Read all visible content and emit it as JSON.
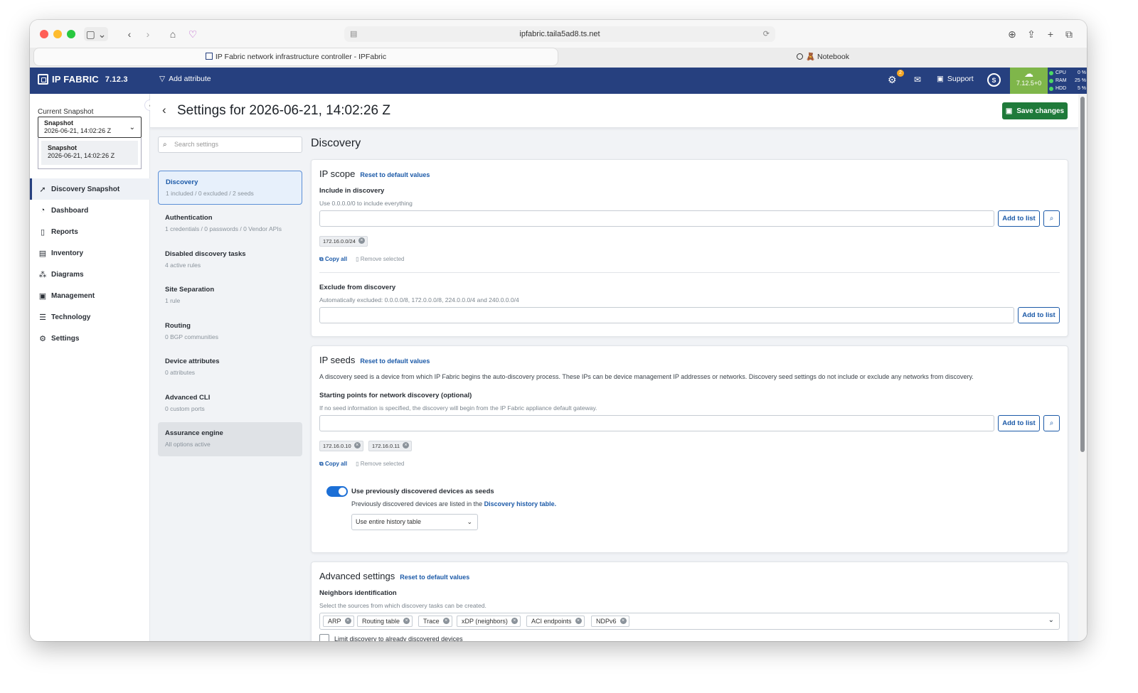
{
  "browser": {
    "url": "ipfabric.taila5ad8.ts.net",
    "tabs": [
      {
        "label": "IP Fabric network infrastructure controller - IPFabric"
      },
      {
        "label": "🧸 Notebook"
      }
    ]
  },
  "header": {
    "brand": "IP FABRIC",
    "version": "7.12.3",
    "add_attribute": "Add attribute",
    "notification_count": "2",
    "support": "Support",
    "cloud_version": "7.12.5+0",
    "stats": [
      {
        "label": "CPU",
        "value": "0 %"
      },
      {
        "label": "RAM",
        "value": "25 %"
      },
      {
        "label": "HDD",
        "value": "5 %"
      }
    ]
  },
  "sidebar": {
    "current_snapshot_label": "Current Snapshot",
    "snapshot_select": {
      "title": "Snapshot",
      "value": "2026-06-21, 14:02:26 Z"
    },
    "snapshot_option": {
      "title": "Snapshot",
      "value": "2026-06-21, 14:02:26 Z"
    },
    "items": [
      {
        "label": "Discovery Snapshot",
        "icon": "rocket-icon"
      },
      {
        "label": "Dashboard",
        "icon": "dashboard-icon"
      },
      {
        "label": "Reports",
        "icon": "report-icon"
      },
      {
        "label": "Inventory",
        "icon": "inventory-icon"
      },
      {
        "label": "Diagrams",
        "icon": "diagram-icon"
      },
      {
        "label": "Management",
        "icon": "management-icon"
      },
      {
        "label": "Technology",
        "icon": "technology-icon"
      },
      {
        "label": "Settings",
        "icon": "gear-icon"
      }
    ]
  },
  "page": {
    "title": "Settings for 2026-06-21, 14:02:26 Z",
    "save_label": "Save changes",
    "search_placeholder": "Search settings",
    "section_title": "Discovery"
  },
  "settings_menu": [
    {
      "title": "Discovery",
      "subtitle": "1 included / 0 excluded / 2 seeds"
    },
    {
      "title": "Authentication",
      "subtitle": "1 credentials / 0 passwords / 0 Vendor APIs"
    },
    {
      "title": "Disabled discovery tasks",
      "subtitle": "4 active rules"
    },
    {
      "title": "Site Separation",
      "subtitle": "1 rule"
    },
    {
      "title": "Routing",
      "subtitle": "0 BGP communities"
    },
    {
      "title": "Device attributes",
      "subtitle": "0 attributes"
    },
    {
      "title": "Advanced CLI",
      "subtitle": "0 custom ports"
    },
    {
      "title": "Assurance engine",
      "subtitle": "All options active"
    }
  ],
  "ip_scope": {
    "title": "IP scope",
    "reset": "Reset to default values",
    "include_label": "Include in discovery",
    "include_hint": "Use 0.0.0.0/0 to include everything",
    "add_label": "Add to list",
    "include_chips": [
      "172.16.0.0/24"
    ],
    "copy_all": "Copy all",
    "remove_selected": "Remove selected",
    "exclude_label": "Exclude from discovery",
    "exclude_hint": "Automatically excluded: 0.0.0.0/8, 172.0.0.0/8, 224.0.0.0/4 and 240.0.0.0/4",
    "exclude_add_label": "Add to list"
  },
  "ip_seeds": {
    "title": "IP seeds",
    "reset": "Reset to default values",
    "description": "A discovery seed is a device from which IP Fabric begins the auto-discovery process. These IPs can be device management IP addresses or networks. Discovery seed settings do not include or exclude any networks from discovery.",
    "start_label": "Starting points for network discovery (optional)",
    "start_hint": "If no seed information is specified, the discovery will begin from the IP Fabric appliance default gateway.",
    "add_label": "Add to list",
    "chips": [
      "172.16.0.10",
      "172.16.0.11"
    ],
    "copy_all": "Copy all",
    "remove_selected": "Remove selected",
    "toggle_label": "Use previously discovered devices as seeds",
    "toggle_hint": "Previously discovered devices are listed in the",
    "toggle_link": "Discovery history table.",
    "history_select": "Use entire history table"
  },
  "advanced": {
    "title": "Advanced settings",
    "reset": "Reset to default values",
    "neighbors_label": "Neighbors identification",
    "neighbors_hint": "Select the sources from which discovery tasks can be created.",
    "neighbors_chips": [
      "ARP",
      "Routing table",
      "Trace",
      "xDP (neighbors)",
      "ACI endpoints",
      "NDPv6"
    ],
    "limit_label": "Limit discovery to already discovered devices"
  }
}
